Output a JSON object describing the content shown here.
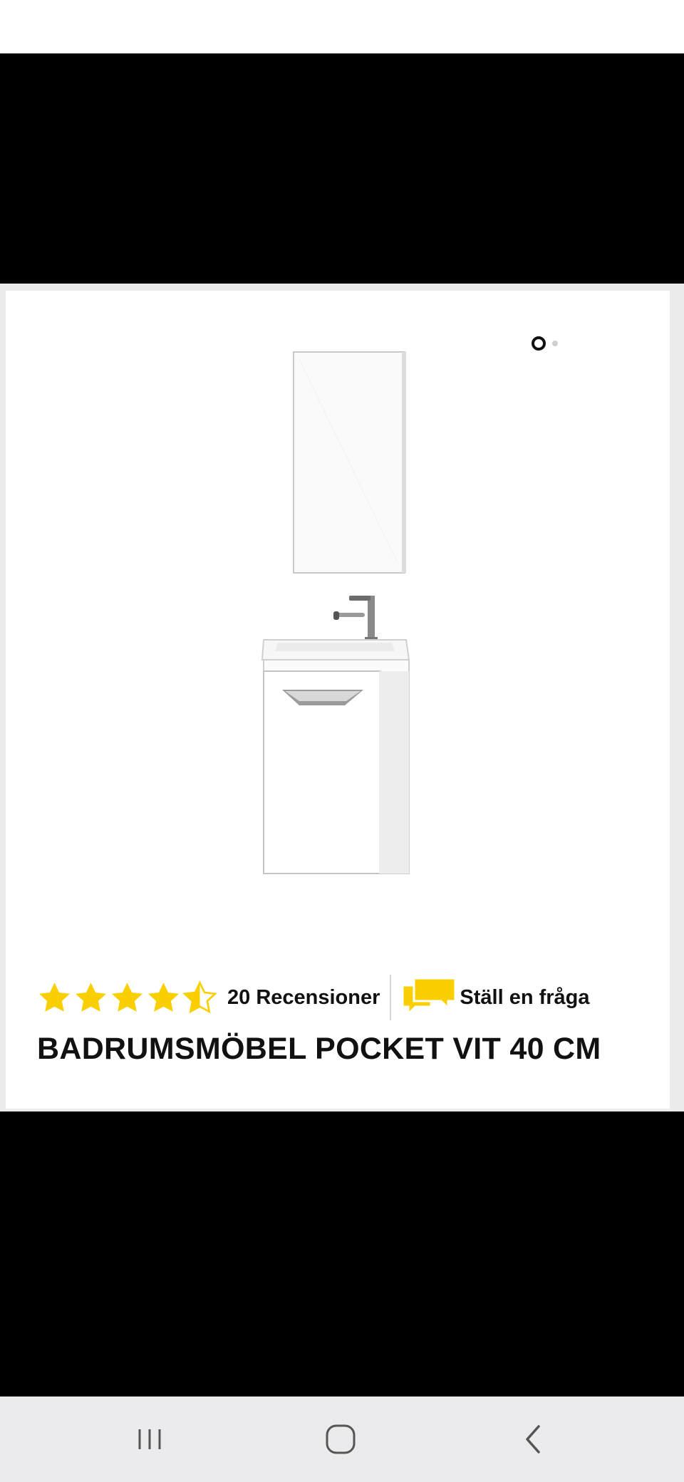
{
  "carousel": {
    "total_slides": 2,
    "active_index": 0
  },
  "product": {
    "title": "BADRUMSMÖBEL POCKET VIT 40 CM",
    "rating": 4.5,
    "max_rating": 5,
    "review_count_label": "20 Recensioner",
    "ask_question_label": "Ställ en fråga",
    "image_icon": "bathroom-furniture-mirror-sink-cabinet"
  },
  "colors": {
    "star": "#f9cf00",
    "ask_icon": "#f9cf00",
    "text": "#111111",
    "background": "#ffffff",
    "navbar": "#ebebed"
  },
  "navbar": {
    "icons": [
      "recent-apps-icon",
      "home-icon",
      "back-icon"
    ]
  }
}
